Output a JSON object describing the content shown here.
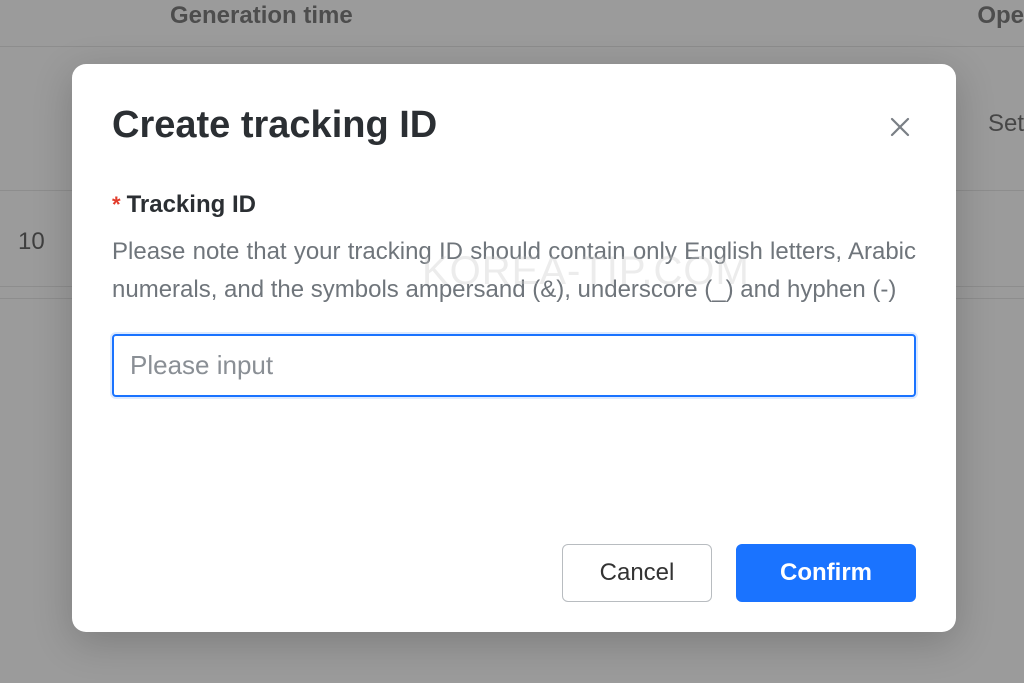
{
  "background": {
    "header": {
      "generation_time": "Generation time",
      "ope": "Ope"
    },
    "set_text": "Set ",
    "ten": "10"
  },
  "watermark": "KOREA-TIP.COM",
  "modal": {
    "title": "Create tracking ID",
    "field": {
      "asterisk": "*",
      "label": "Tracking ID",
      "hint": "Please note that your tracking ID should contain only English letters, Arabic numerals, and the symbols ampersand (&), underscore (_) and hyphen (-)",
      "placeholder": "Please input"
    },
    "buttons": {
      "cancel": "Cancel",
      "confirm": "Confirm"
    }
  }
}
